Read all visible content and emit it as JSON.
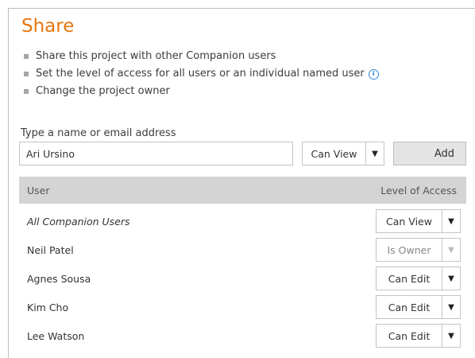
{
  "title": "Share",
  "bullets": [
    "Share this project with other Companion users",
    "Set the level of access for all users or an individual named user",
    "Change the project owner"
  ],
  "info_icon": "info-icon",
  "invite": {
    "label": "Type a name or email address",
    "value": "Ari Ursino",
    "access": "Can View",
    "add_label": "Add"
  },
  "table": {
    "col_user": "User",
    "col_access": "Level of Access",
    "rows": [
      {
        "name": "All Companion Users",
        "access": "Can View",
        "italic": true,
        "disabled": false
      },
      {
        "name": "Neil Patel",
        "access": "Is Owner",
        "italic": false,
        "disabled": true
      },
      {
        "name": "Agnes Sousa",
        "access": "Can Edit",
        "italic": false,
        "disabled": false
      },
      {
        "name": "Kim Cho",
        "access": "Can Edit",
        "italic": false,
        "disabled": false
      },
      {
        "name": "Lee Watson",
        "access": "Can Edit",
        "italic": false,
        "disabled": false
      }
    ]
  },
  "colors": {
    "title": "#e8750e",
    "info": "#2f84d8",
    "header_bg": "#d4d4d4"
  }
}
